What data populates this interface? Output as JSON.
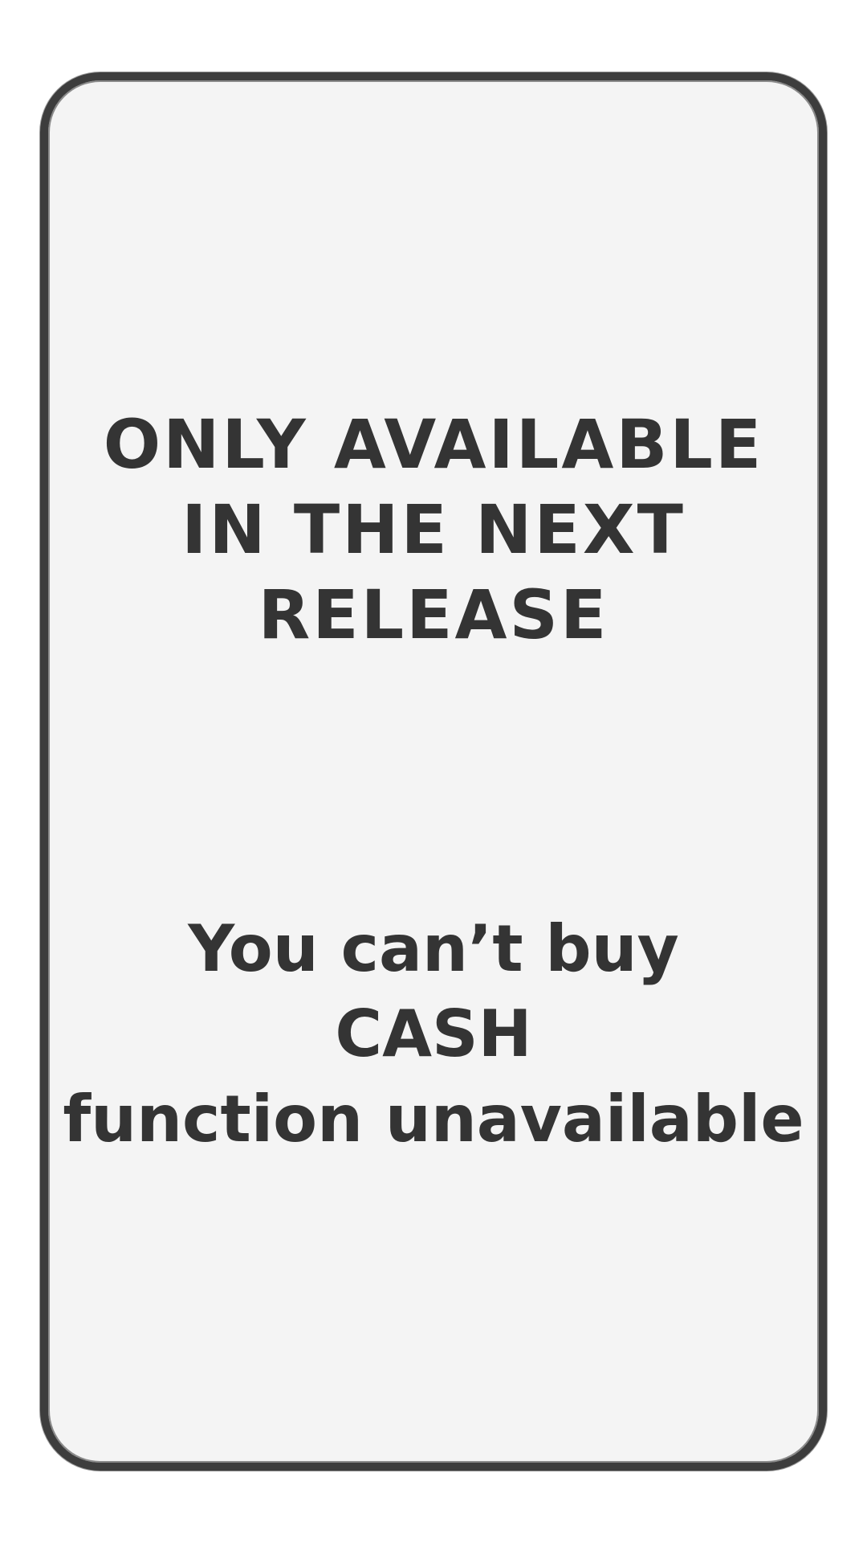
{
  "notice": {
    "headline_lines": [
      "ONLY AVAILABLE",
      "IN THE NEXT",
      "RELEASE"
    ],
    "message_lines": [
      "You can’t buy",
      "CASH",
      "function unavailable"
    ]
  },
  "colors": {
    "background": "#ffffff",
    "card": "#f4f4f4",
    "border": "#3d3d3d",
    "text": "#343434"
  }
}
